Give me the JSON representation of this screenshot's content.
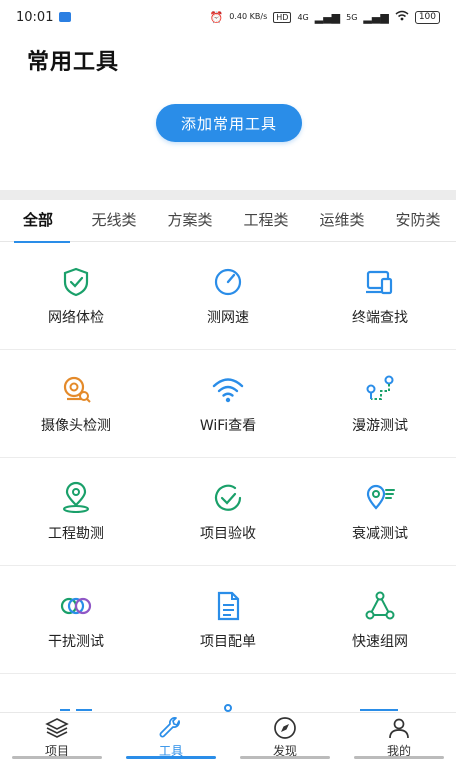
{
  "status_bar": {
    "time": "10:01",
    "net_speed": "0.40 KB/s",
    "network_4g": "4G",
    "network_5g": "5G",
    "battery": "100"
  },
  "header": {
    "title": "常用工具",
    "add_button": "添加常用工具"
  },
  "tabs": [
    "全部",
    "无线类",
    "方案类",
    "工程类",
    "运维类",
    "安防类"
  ],
  "tools": [
    {
      "label": "网络体检",
      "icon": "shield-check-icon"
    },
    {
      "label": "测网速",
      "icon": "speedometer-icon"
    },
    {
      "label": "终端查找",
      "icon": "devices-icon"
    },
    {
      "label": "摄像头检测",
      "icon": "camera-search-icon"
    },
    {
      "label": "WiFi查看",
      "icon": "wifi-icon"
    },
    {
      "label": "漫游测试",
      "icon": "roaming-route-icon"
    },
    {
      "label": "工程勘测",
      "icon": "location-survey-icon"
    },
    {
      "label": "项目验收",
      "icon": "check-circle-icon"
    },
    {
      "label": "衰减测试",
      "icon": "signal-attenuation-icon"
    },
    {
      "label": "干扰测试",
      "icon": "interference-rings-icon"
    },
    {
      "label": "项目配单",
      "icon": "document-icon"
    },
    {
      "label": "快速组网",
      "icon": "network-triangle-icon"
    }
  ],
  "bottom_nav": [
    {
      "label": "项目",
      "icon": "layers-icon"
    },
    {
      "label": "工具",
      "icon": "wrench-icon"
    },
    {
      "label": "发现",
      "icon": "compass-icon"
    },
    {
      "label": "我的",
      "icon": "user-icon"
    }
  ],
  "colors": {
    "accent": "#2a8de8",
    "green": "#1aa06a",
    "orange": "#e48a2a",
    "purple": "#8f57c6"
  }
}
